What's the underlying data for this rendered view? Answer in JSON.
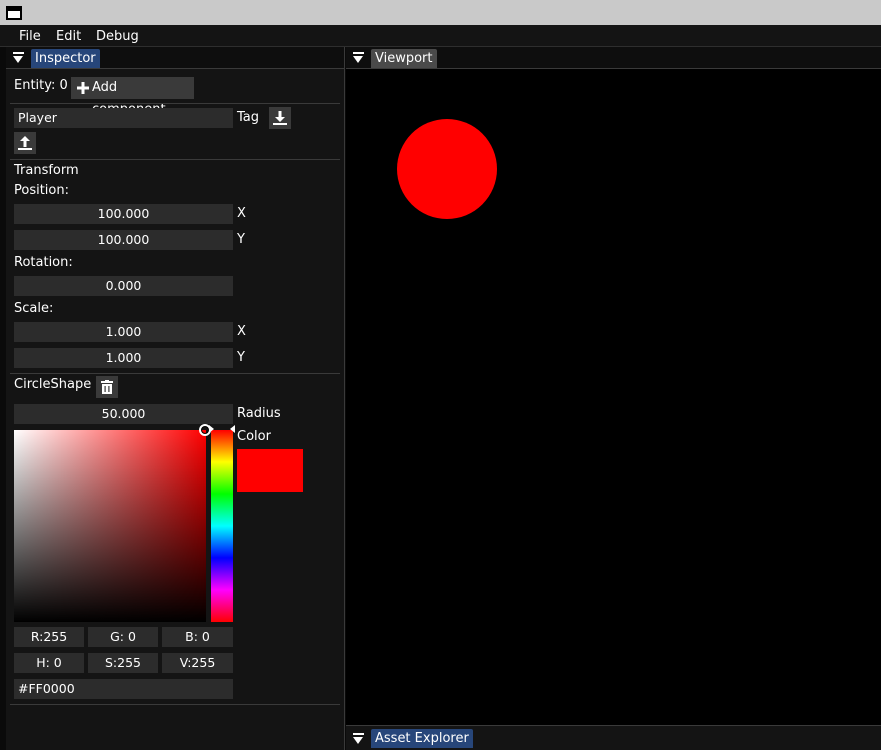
{
  "menu": {
    "file": "File",
    "edit": "Edit",
    "debug": "Debug"
  },
  "inspector": {
    "tab": "Inspector",
    "entity_label": "Entity: 0",
    "add_component": "Add component",
    "name_value": "Player",
    "tag_label": "Tag",
    "transform": {
      "title": "Transform",
      "position_label": "Position:",
      "position_x": "100.000",
      "position_y": "100.000",
      "x_label": "X",
      "y_label": "Y",
      "rotation_label": "Rotation:",
      "rotation": "0.000",
      "scale_label": "Scale:",
      "scale_x": "1.000",
      "scale_y": "1.000"
    },
    "circle_shape": {
      "title": "CircleShape",
      "radius": "50.000",
      "radius_label": "Radius",
      "color_label": "Color",
      "r": "R:255",
      "g": "G:  0",
      "b": "B:  0",
      "h": "H:  0",
      "s": "S:255",
      "v": "V:255",
      "hex": "#FF0000"
    }
  },
  "viewport": {
    "tab": "Viewport"
  },
  "asset_explorer": {
    "tab": "Asset Explorer"
  },
  "colors": {
    "shape_color": "#ff0000",
    "accent_tab": "#27467a"
  },
  "icons": {
    "add": "plus-icon",
    "download": "download-icon",
    "upload": "upload-icon",
    "delete": "trash-icon",
    "collapse": "collapse-triangle-icon"
  }
}
